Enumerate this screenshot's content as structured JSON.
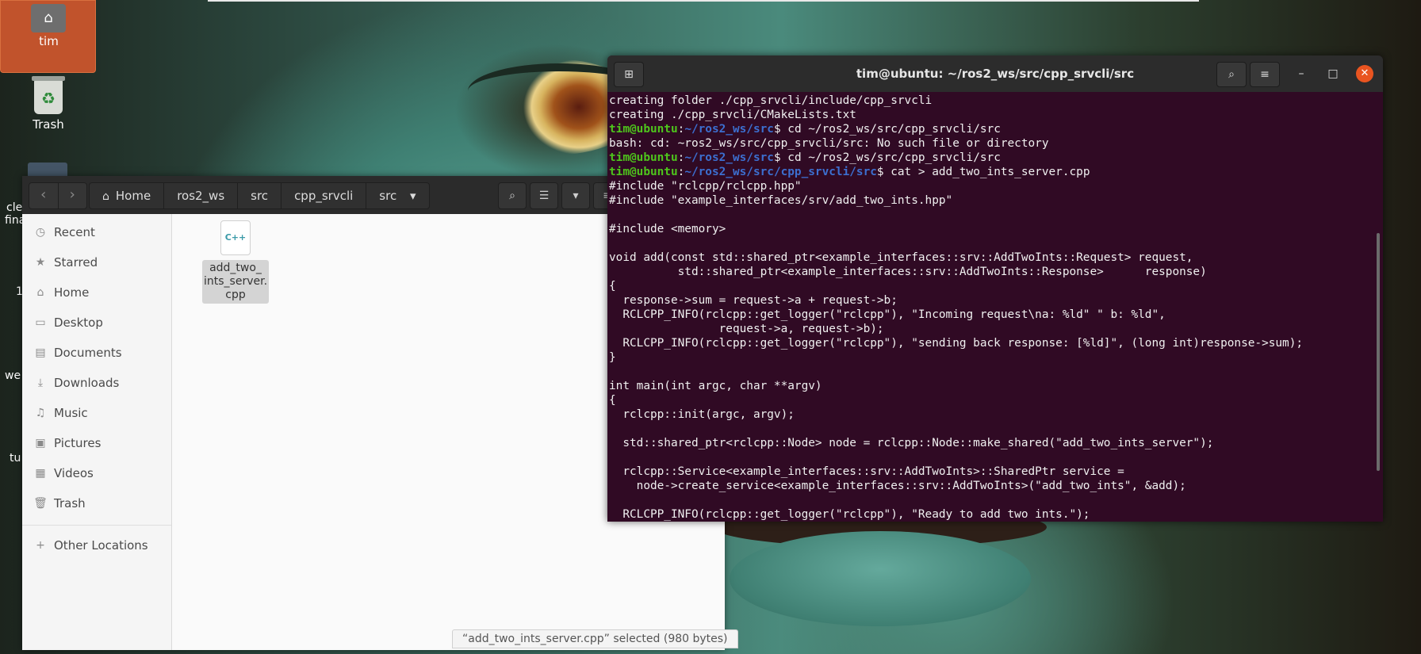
{
  "desktop": {
    "home_label": "tim",
    "trash_label": "Trash",
    "peek_labels": [
      "cle",
      "fina",
      "1",
      "we",
      "tu"
    ]
  },
  "file_manager": {
    "breadcrumb": [
      "Home",
      "ros2_ws",
      "src",
      "cpp_srvcli",
      "src"
    ],
    "sidebar": [
      {
        "icon": "clock-icon",
        "label": "Recent"
      },
      {
        "icon": "star-icon",
        "label": "Starred"
      },
      {
        "icon": "home-icon",
        "label": "Home"
      },
      {
        "icon": "folder-icon",
        "label": "Desktop"
      },
      {
        "icon": "folder-icon",
        "label": "Documents"
      },
      {
        "icon": "download-icon",
        "label": "Downloads"
      },
      {
        "icon": "music-icon",
        "label": "Music"
      },
      {
        "icon": "pictures-icon",
        "label": "Pictures"
      },
      {
        "icon": "videos-icon",
        "label": "Videos"
      },
      {
        "icon": "trash-icon",
        "label": "Trash"
      }
    ],
    "other_locations": "Other Locations",
    "file": {
      "badge": "C++",
      "name": "add_two_ints_server.cpp",
      "display_name": "add_two_\nints_server.\ncpp"
    },
    "status": "“add_two_ints_server.cpp” selected  (980 bytes)"
  },
  "terminal": {
    "title": "tim@ubuntu: ~/ros2_ws/src/cpp_srvcli/src",
    "lines": [
      {
        "text": "creating folder ./cpp_srvcli/include/cpp_srvcli"
      },
      {
        "text": "creating ./cpp_srvcli/CMakeLists.txt"
      },
      {
        "user": "tim@ubuntu",
        "path": "~/ros2_ws/src",
        "cmd": "$ cd ~/ros2_ws/src/cpp_srvcli/src"
      },
      {
        "text": "bash: cd: ~ros2_ws/src/cpp_srvcli/src: No such file or directory"
      },
      {
        "user": "tim@ubuntu",
        "path": "~/ros2_ws/src",
        "cmd": "$ cd ~/ros2_ws/src/cpp_srvcli/src"
      },
      {
        "user": "tim@ubuntu",
        "path": "~/ros2_ws/src/cpp_srvcli/src",
        "cmd": "$ cat > add_two_ints_server.cpp"
      },
      {
        "text": "#include \"rclcpp/rclcpp.hpp\""
      },
      {
        "text": "#include \"example_interfaces/srv/add_two_ints.hpp\""
      },
      {
        "text": ""
      },
      {
        "text": "#include <memory>"
      },
      {
        "text": ""
      },
      {
        "text": "void add(const std::shared_ptr<example_interfaces::srv::AddTwoInts::Request> request,"
      },
      {
        "text": "          std::shared_ptr<example_interfaces::srv::AddTwoInts::Response>      response)"
      },
      {
        "text": "{"
      },
      {
        "text": "  response->sum = request->a + request->b;"
      },
      {
        "text": "  RCLCPP_INFO(rclcpp::get_logger(\"rclcpp\"), \"Incoming request\\na: %ld\" \" b: %ld\","
      },
      {
        "text": "                request->a, request->b);"
      },
      {
        "text": "  RCLCPP_INFO(rclcpp::get_logger(\"rclcpp\"), \"sending back response: [%ld]\", (long int)response->sum);"
      },
      {
        "text": "}"
      },
      {
        "text": ""
      },
      {
        "text": "int main(int argc, char **argv)"
      },
      {
        "text": "{"
      },
      {
        "text": "  rclcpp::init(argc, argv);"
      },
      {
        "text": ""
      },
      {
        "text": "  std::shared_ptr<rclcpp::Node> node = rclcpp::Node::make_shared(\"add_two_ints_server\");"
      },
      {
        "text": ""
      },
      {
        "text": "  rclcpp::Service<example_interfaces::srv::AddTwoInts>::SharedPtr service ="
      },
      {
        "text": "    node->create_service<example_interfaces::srv::AddTwoInts>(\"add_two_ints\", &add);"
      },
      {
        "text": ""
      },
      {
        "text": "  RCLCPP_INFO(rclcpp::get_logger(\"rclcpp\"), \"Ready to add two ints.\");"
      }
    ]
  }
}
